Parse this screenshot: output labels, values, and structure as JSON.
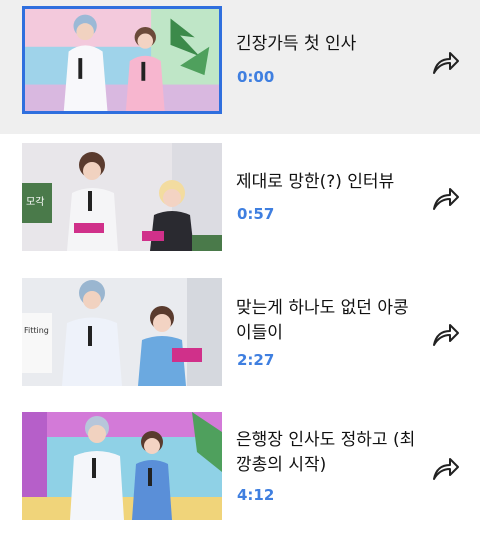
{
  "videos": [
    {
      "title": "긴장가득 첫 인사",
      "duration": "0:00",
      "selected": true
    },
    {
      "title": "제대로 망한(?) 인터뷰",
      "duration": "0:57",
      "selected": false
    },
    {
      "title": "맞는게 하나도 없던 아콩이들이",
      "duration": "2:27",
      "selected": false
    },
    {
      "title": "은행장 인사도 정하고 (최깡총의 시작)",
      "duration": "4:12",
      "selected": false
    }
  ],
  "icons": {
    "share": "share-arrow-icon"
  },
  "colors": {
    "duration": "#3f7fe0",
    "selected_bg": "#efefef",
    "selected_border": "#2f6fde"
  }
}
